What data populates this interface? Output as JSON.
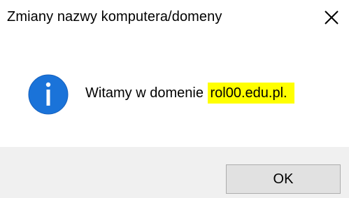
{
  "window": {
    "title": "Zmiany nazwy komputera/domeny"
  },
  "message": {
    "text_prefix": "Witamy w domenie ",
    "text_highlighted": "rol00.edu.pl.",
    "icon": "information-icon"
  },
  "buttons": {
    "ok_label": "OK"
  },
  "colors": {
    "info_icon": "#1a73d9",
    "highlight": "#ffff00",
    "footer_bg": "#f0f0f0",
    "button_bg": "#e1e1e1",
    "button_border": "#adadad"
  }
}
